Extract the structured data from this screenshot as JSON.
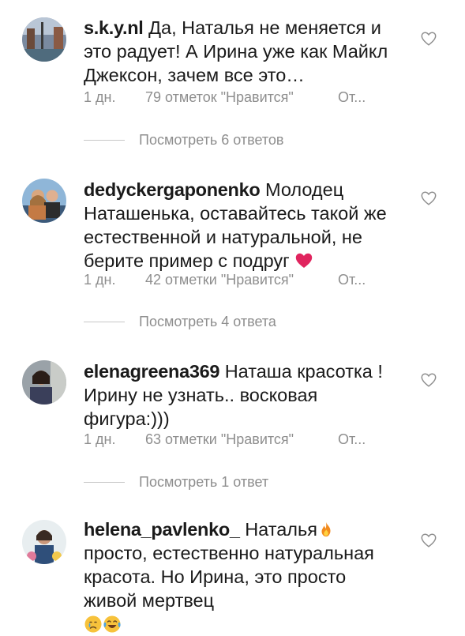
{
  "comments": [
    {
      "username": "s.k.y.nl",
      "text": "Да, Наталья не меняется и это радует! А Ирина уже как Майкл Джексон, зачем все это…",
      "time": "1 дн.",
      "likes": "79 отметок \"Нравится\"",
      "reply": "От...",
      "view_replies": "Посмотреть 6 ответов"
    },
    {
      "username": "dedyckergaponenko",
      "text": "Молодец Наташенька,  оставайтесь такой же естественной и натуральной, не берите пример с подруг",
      "time": "1 дн.",
      "likes": "42 отметки \"Нравится\"",
      "reply": "От...",
      "view_replies": "Посмотреть 4 ответа"
    },
    {
      "username": "elenagreena369",
      "text": "Наташа красотка ! Ирину не узнать.. восковая фигура:)))",
      "time": "1 дн.",
      "likes": "63 отметки \"Нравится\"",
      "reply": "От...",
      "view_replies": "Посмотреть 1 ответ"
    },
    {
      "username": "helena_pavlenko_",
      "text_a": "Наталья",
      "text_b": " просто, естественно натуральная красота. Но Ирина, это просто живой мертвец"
    }
  ],
  "icons": {
    "like": "heart-outline-icon",
    "emoji_heart": "red-heart-emoji",
    "emoji_fire": "fire-emoji",
    "emoji_crying": "crying-face-emoji",
    "emoji_laughing": "tears-of-joy-emoji"
  },
  "colors": {
    "meta": "#8e8e8e",
    "text": "#1a1a1a",
    "heart_emoji": "#e0245e"
  }
}
